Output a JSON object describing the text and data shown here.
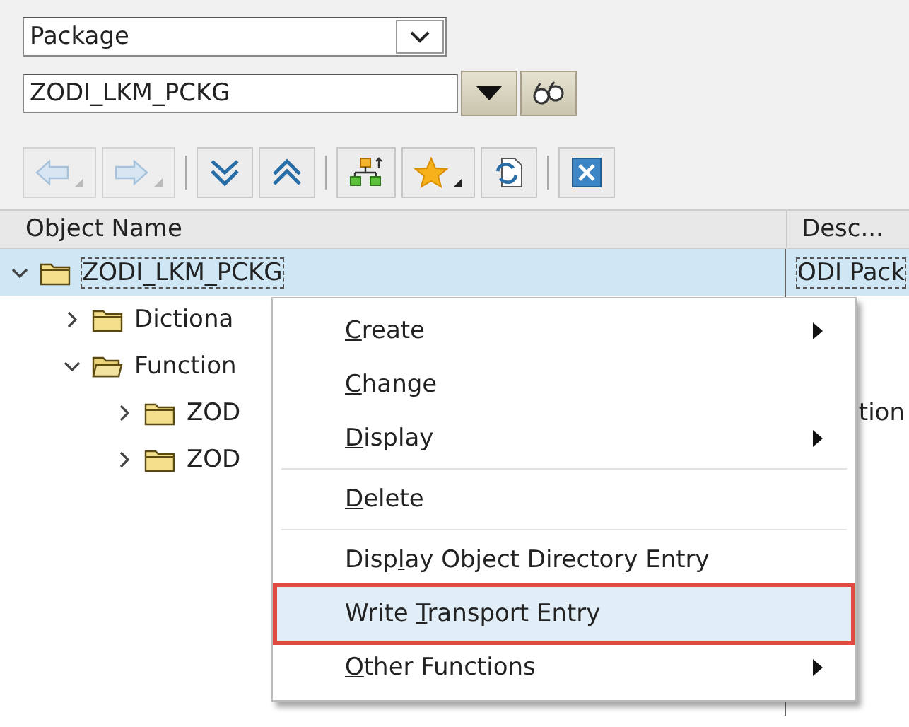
{
  "object_type": {
    "value": "Package"
  },
  "object_name": {
    "value": "ZODI_LKM_PCKG"
  },
  "toolbar": [
    {
      "disabled": true,
      "dropdown": true
    },
    {
      "disabled": true,
      "dropdown": true
    },
    {
      "disabled": false,
      "dropdown": false
    },
    {
      "disabled": false,
      "dropdown": false
    },
    {
      "disabled": false,
      "dropdown": false
    },
    {
      "disabled": false,
      "dropdown": true
    },
    {
      "disabled": false,
      "dropdown": false
    },
    {
      "disabled": false,
      "dropdown": false
    }
  ],
  "columns": [
    "Object Name",
    "Desc..."
  ],
  "tree": [
    {
      "label": "ZODI_LKM_PCKG",
      "description": "ODI Pack",
      "expanded": true,
      "selected": true,
      "children": [
        {
          "label": "Dictiona",
          "expanded": false,
          "selected": false,
          "open_folder": false
        },
        {
          "label": "Function",
          "expanded": true,
          "selected": false,
          "open_folder": true,
          "children": [
            {
              "label": "ZOD",
              "description": "tion",
              "expanded": false,
              "selected": false,
              "open_folder": false
            },
            {
              "label": "ZOD",
              "expanded": false,
              "selected": false,
              "open_folder": false
            }
          ]
        }
      ]
    }
  ],
  "context_menu": [
    {
      "kind": "item",
      "key": "C",
      "post": "reate",
      "submenu": true,
      "selected": false
    },
    {
      "kind": "item",
      "key": "C",
      "post": "hange",
      "submenu": false,
      "selected": false
    },
    {
      "kind": "item",
      "key": "D",
      "post": "isplay",
      "submenu": true,
      "selected": false
    },
    {
      "kind": "separator"
    },
    {
      "kind": "item",
      "key": "D",
      "post": "elete",
      "submenu": false,
      "selected": false
    },
    {
      "kind": "separator"
    },
    {
      "kind": "item",
      "pre": "Disp",
      "key": "l",
      "post": "ay Object Directory Entry",
      "submenu": false,
      "selected": false
    },
    {
      "kind": "item",
      "pre": "Write ",
      "key": "T",
      "post": "ransport Entry",
      "submenu": false,
      "selected": true
    },
    {
      "kind": "item",
      "key": "O",
      "post": "ther Functions",
      "submenu": true,
      "selected": false
    }
  ]
}
